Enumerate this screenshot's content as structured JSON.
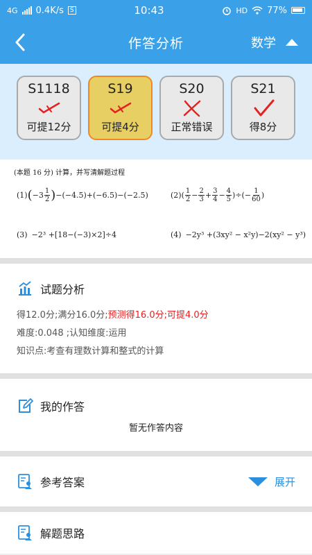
{
  "status_bar": {
    "network": "4G",
    "speed": "0.4K/s",
    "s_badge": "S",
    "time": "10:43",
    "hd": "HD",
    "battery": "77%"
  },
  "header": {
    "title": "作答分析",
    "subject": "数学"
  },
  "cards": [
    {
      "id": "S1118",
      "status": "可提12分",
      "mark": "check-x",
      "active": false
    },
    {
      "id": "S19",
      "status": "可提4分",
      "mark": "check-x",
      "active": true
    },
    {
      "id": "S20",
      "status": "正常错误",
      "mark": "cross",
      "active": false
    },
    {
      "id": "S21",
      "status": "得8分",
      "mark": "check",
      "active": false
    }
  ],
  "question": {
    "intro": "(本题 16 分) 计算，并写清解题过程",
    "p1_label": "(1)",
    "p1_a": "−3",
    "p1_num": "1",
    "p1_den": "2",
    "p1_rest": "−(−4.5)+(−6.5)−(−2.5)",
    "p2_label": "(2)",
    "p2_f1n": "1",
    "p2_f1d": "2",
    "p2_f2n": "2",
    "p2_f2d": "3",
    "p2_f3n": "3",
    "p2_f3d": "4",
    "p2_f4n": "4",
    "p2_f4d": "5",
    "p2_f5n": "1",
    "p2_f5d": "60",
    "p3_label": "(3)",
    "p3_expr": "−2³ +[18−(−3)×2]÷4",
    "p4_label": "(4)",
    "p4_expr": "−2y³ +(3xy² − x²y)−2(xy² − y³)"
  },
  "analysis": {
    "title": "试题分析",
    "score_prefix": "得12.0分;满分16.0分;",
    "score_red": "预测得16.0分;可提4.0分",
    "difficulty": "难度:0.048 ;认知维度:运用",
    "knowledge": "知识点:考查有理数计算和整式的计算"
  },
  "my_answer": {
    "title": "我的作答",
    "empty": "暂无作答内容"
  },
  "reference": {
    "title": "参考答案",
    "expand": "展开"
  },
  "thinking": {
    "title": "解题思路"
  },
  "colors": {
    "primary": "#3aa0e8",
    "card_active_bg": "#e8cf63",
    "card_active_border": "#ee8a1d",
    "mark_red": "#e52020",
    "link_blue": "#2b8fde"
  }
}
